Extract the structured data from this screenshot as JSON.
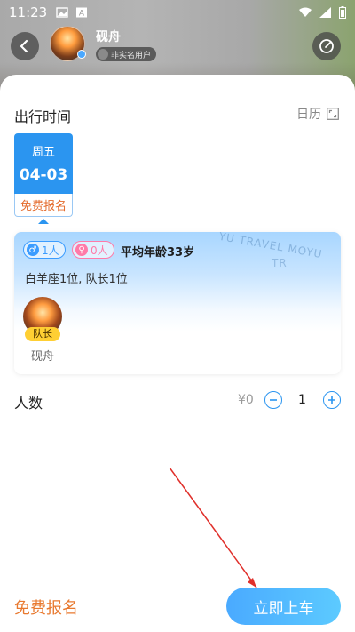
{
  "status_bar": {
    "time": "11:23"
  },
  "header": {
    "user_name": "砚舟",
    "real_name_badge": "非实名用户"
  },
  "trip": {
    "section_title": "出行时间",
    "calendar_label": "日历",
    "date_chip": {
      "day_of_week": "周五",
      "date": "04-03",
      "price_label": "免费报名"
    },
    "card": {
      "male_count": "1人",
      "female_count": "0人",
      "avg_age": "平均年龄33岁",
      "constellation": "白羊座1位, 队长1位",
      "watermark_1": "YU TRAVEL MOYU",
      "watermark_2": "TR",
      "member": {
        "role": "队长",
        "name": "砚舟"
      }
    }
  },
  "people": {
    "label": "人数",
    "price": "¥0",
    "quantity": "1"
  },
  "bottom_bar": {
    "free_label": "免费报名",
    "board_button": "立即上车"
  }
}
